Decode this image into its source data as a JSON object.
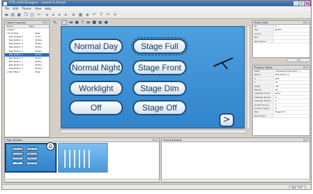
{
  "window": {
    "title": "STD cs18 Designer - search & thrust",
    "controls": [
      "_",
      "□",
      "x"
    ]
  },
  "menu": [
    "File",
    "Edit",
    "Theme",
    "View",
    "Help"
  ],
  "toolbar": {
    "icons": [
      "new-icon",
      "open-icon",
      "save-icon",
      "copy-icon",
      "paste-icon",
      "cut-icon",
      "align-icon",
      "align-icon",
      "align-icon",
      "align-icon",
      "zoom-icon",
      "grid-icon",
      "bullet-icon",
      "undo-icon",
      "text-icon",
      "redo-icon",
      "delete-icon"
    ]
  },
  "object_inspector": {
    "title": "Object Inspector",
    "columns": [
      "Name",
      "Type"
    ],
    "rows": [
      {
        "name": "- untitled",
        "type": "",
        "selected": false
      },
      {
        "name": "  - Front Page",
        "type": "Page",
        "selected": false
      },
      {
        "name": "      New Widget 1",
        "type": "Clock",
        "selected": false
      },
      {
        "name": "      New Button 1",
        "type": "Button",
        "selected": false
      },
      {
        "name": "      New Button 2",
        "type": "Button",
        "selected": false
      },
      {
        "name": "      New Button 3",
        "type": "Button",
        "selected": false
      },
      {
        "name": "      New Button 4",
        "type": "Button",
        "selected": false
      },
      {
        "name": "      New Button 5",
        "type": "Button",
        "selected": true
      },
      {
        "name": "      New Button 6",
        "type": "Button",
        "selected": false
      },
      {
        "name": "      New Button 7",
        "type": "Button",
        "selected": false
      },
      {
        "name": "      New Button 8",
        "type": "Button",
        "selected": false
      },
      {
        "name": "      New Button 9",
        "type": "Button",
        "selected": false
      },
      {
        "name": "  + New Page 1",
        "type": "Page",
        "selected": false
      }
    ]
  },
  "design": {
    "page_tab_icon": "arrow-icon",
    "buttons": [
      {
        "label": "Normal Day",
        "selected": false
      },
      {
        "label": "Stage Full",
        "selected": true
      },
      {
        "label": "Normal Night",
        "selected": false
      },
      {
        "label": "Stage Front",
        "selected": false
      },
      {
        "label": "Worklight",
        "selected": false
      },
      {
        "label": "Stage Dim",
        "selected": false
      },
      {
        "label": "Off",
        "selected": false
      },
      {
        "label": "Stage Off",
        "selected": false
      }
    ],
    "next_button": ">"
  },
  "state_editor": {
    "title": "State Editor",
    "rows": [
      {
        "k": "ID",
        "v": "1"
      },
      {
        "k": "Tag",
        "v": "Button"
      },
      {
        "k": "Colour",
        "v": ""
      },
      {
        "k": "Text",
        "v": ""
      },
      {
        "k": "Text Colour",
        "v": ""
      }
    ]
  },
  "property_editor": {
    "title": "Property Editor",
    "rows": [
      {
        "k": "UUID",
        "v": "{b1aea3b0-f96f-4b13...}"
      },
      {
        "k": "Name",
        "v": "New Button 5"
      },
      {
        "k": "X",
        "v": "185"
      },
      {
        "k": "Y",
        "v": "30"
      },
      {
        "k": "Width",
        "v": "155"
      },
      {
        "k": "Height",
        "v": "46"
      },
      {
        "k": "Visibility Group",
        "v": "None"
      },
      {
        "k": "Visibility Theme",
        "v": "0"
      },
      {
        "k": "Visibility Theme",
        "v": "0"
      },
      {
        "k": "Control Group",
        "v": "0"
      },
      {
        "k": "Control Theme",
        "v": "0"
      },
      {
        "k": "Text",
        "v": "Stage Full"
      },
      {
        "k": "Text Colour",
        "v": ""
      }
    ]
  },
  "page_browser": {
    "title": "Page Browser",
    "thumb_buttons": [
      "Normal Day",
      "Stage Full",
      "Normal Night",
      "Stage Front",
      "Worklight",
      "Stage Dim",
      "Off",
      "Stage Off"
    ]
  },
  "theme_browser": {
    "title": "Theme Browser"
  },
  "status": {
    "text": "Idle, 10%"
  }
}
